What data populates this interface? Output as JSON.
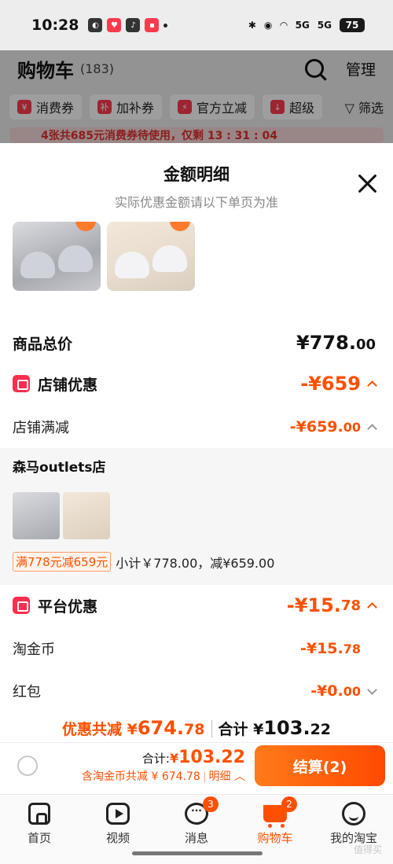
{
  "status_bar": {
    "time": "10:28",
    "battery": "75",
    "network": "5G"
  },
  "background": {
    "title": "购物车",
    "count": "(183)",
    "manage": "管理",
    "chips": [
      "消费券",
      "加补券",
      "官方立减",
      "超级"
    ],
    "filter": "筛选",
    "banner": "4张共685元消费券待使用，仅剩 13 : 31 : 04"
  },
  "sheet": {
    "title": "金额明细",
    "subtitle": "实际优惠金额请以下单页为准",
    "goods_total_label": "商品总价",
    "goods_total_main": "¥778.",
    "goods_total_dec": "00",
    "store_discount": {
      "label": "店铺优惠",
      "amount": "-¥659",
      "sub_label": "店铺满减",
      "sub_amount_main": "-¥659.",
      "sub_amount_dec": "00"
    },
    "shop": {
      "name": "森马outlets店",
      "promo_tag": "满778元减659元",
      "subtotal": "小计￥778.00，减¥659.00"
    },
    "platform_discount": {
      "label": "平台优惠",
      "amount_main": "-¥15.",
      "amount_dec": "78",
      "items": [
        {
          "label": "淘金币",
          "amount_main": "-¥15.",
          "amount_dec": "78"
        },
        {
          "label": "红包",
          "amount_main": "-¥0.",
          "amount_dec": "00"
        }
      ]
    },
    "summary": {
      "discount_label": "优惠共减 ¥",
      "discount_main": "674.",
      "discount_dec": "78",
      "total_label": "合计 ¥",
      "total_main": "103.",
      "total_dec": "22"
    }
  },
  "action_bar": {
    "total_label": "合计:",
    "total_currency": "¥",
    "total_value": "103.22",
    "detail_text": "含淘金币共减 ¥ 674.78",
    "detail_link": "明细",
    "checkout": "结算(2)"
  },
  "tabs": [
    {
      "label": "首页",
      "badge": ""
    },
    {
      "label": "视频",
      "badge": ""
    },
    {
      "label": "消息",
      "badge": "3"
    },
    {
      "label": "购物车",
      "badge": "2"
    },
    {
      "label": "我的淘宝",
      "badge": ""
    }
  ],
  "watermark": "值得买",
  "colors": {
    "accent": "#ff5000",
    "icon_red": "#ff2d4e"
  }
}
